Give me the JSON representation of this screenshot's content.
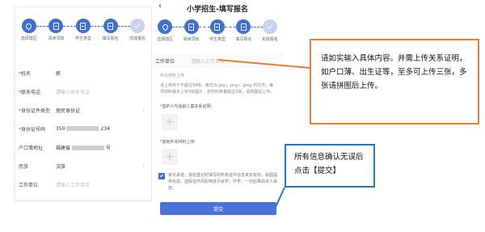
{
  "left_screen": {
    "steps": [
      {
        "label": "选择辖区",
        "icon": "location-pin-icon",
        "done": true
      },
      {
        "label": "阅读须知",
        "icon": "document-icon",
        "done": true
      },
      {
        "label": "学生类型",
        "icon": "document-icon",
        "done": true
      },
      {
        "label": "填写报名",
        "icon": "document-icon",
        "done": true
      },
      {
        "label": "完成报名",
        "icon": "check-icon",
        "done": false
      }
    ],
    "fields": [
      {
        "label": "姓名",
        "required": true,
        "value": "郎",
        "placeholder": "",
        "arrow": false,
        "blurred": false
      },
      {
        "label": "联系电话",
        "required": true,
        "value": "",
        "placeholder": "请输入联系电话",
        "arrow": false,
        "blurred": false
      },
      {
        "label": "身份证件类型",
        "required": true,
        "value": "居民身份证",
        "placeholder": "",
        "arrow": true,
        "blurred": false
      },
      {
        "label": "身份证号码",
        "required": true,
        "value": "350",
        "value_suffix": "234",
        "placeholder": "",
        "arrow": false,
        "blurred": true
      },
      {
        "label": "户口簿地址",
        "required": false,
        "value": "福建省",
        "value_suffix": "号",
        "placeholder": "",
        "arrow": false,
        "blurred": true
      },
      {
        "label": "民族",
        "required": false,
        "value": "汉族",
        "placeholder": "",
        "arrow": true,
        "blurred": false
      },
      {
        "label": "工作单位",
        "required": false,
        "value": "",
        "placeholder": "请输入工作单位",
        "arrow": false,
        "blurred": false
      }
    ]
  },
  "mid_screen": {
    "title": "小学招生-填写报名",
    "back_icon": "chevron-left-icon",
    "steps": [
      {
        "label": "选择辖区",
        "icon": "location-pin-icon",
        "done": true
      },
      {
        "label": "阅读须知",
        "icon": "document-icon",
        "done": true
      },
      {
        "label": "学生类型",
        "icon": "document-icon",
        "done": true
      },
      {
        "label": "填写报名",
        "icon": "document-icon",
        "done": true
      },
      {
        "label": "完成报名",
        "icon": "check-icon",
        "done": false
      }
    ],
    "work_label": "工作单位",
    "work_placeholder": "请输入工作单位",
    "section_title": "补充材料上传",
    "upload_hint": "请上传单个不超过5MB，格式为.jpg / .png / .jpeg 的文件，每项材料最多上传3张图片，若材料数量超过3张，请拼图后上传。",
    "upload1_label": "监护人与适龄儿童关系证明：",
    "upload2_label": "其他补充材料上传：",
    "promise_text": "家长承诺：报名登记时填写的所有证件信息真实有效，如因提供伪造、虚假证件而影响孩子就学，升学，一切后果由本人承担。",
    "submit_label": "提交"
  },
  "callouts": {
    "orange_text": "请如实输入具体内容。并需上传关系证明，如户口薄、出生证等，至多可上传三张，多张请拼图后上传。",
    "blue_text": "所有信息确认无误后点击【提交】",
    "colors": {
      "orange": "#ed7d31",
      "blue": "#2e75b6",
      "accent": "#3f6fd0"
    }
  }
}
